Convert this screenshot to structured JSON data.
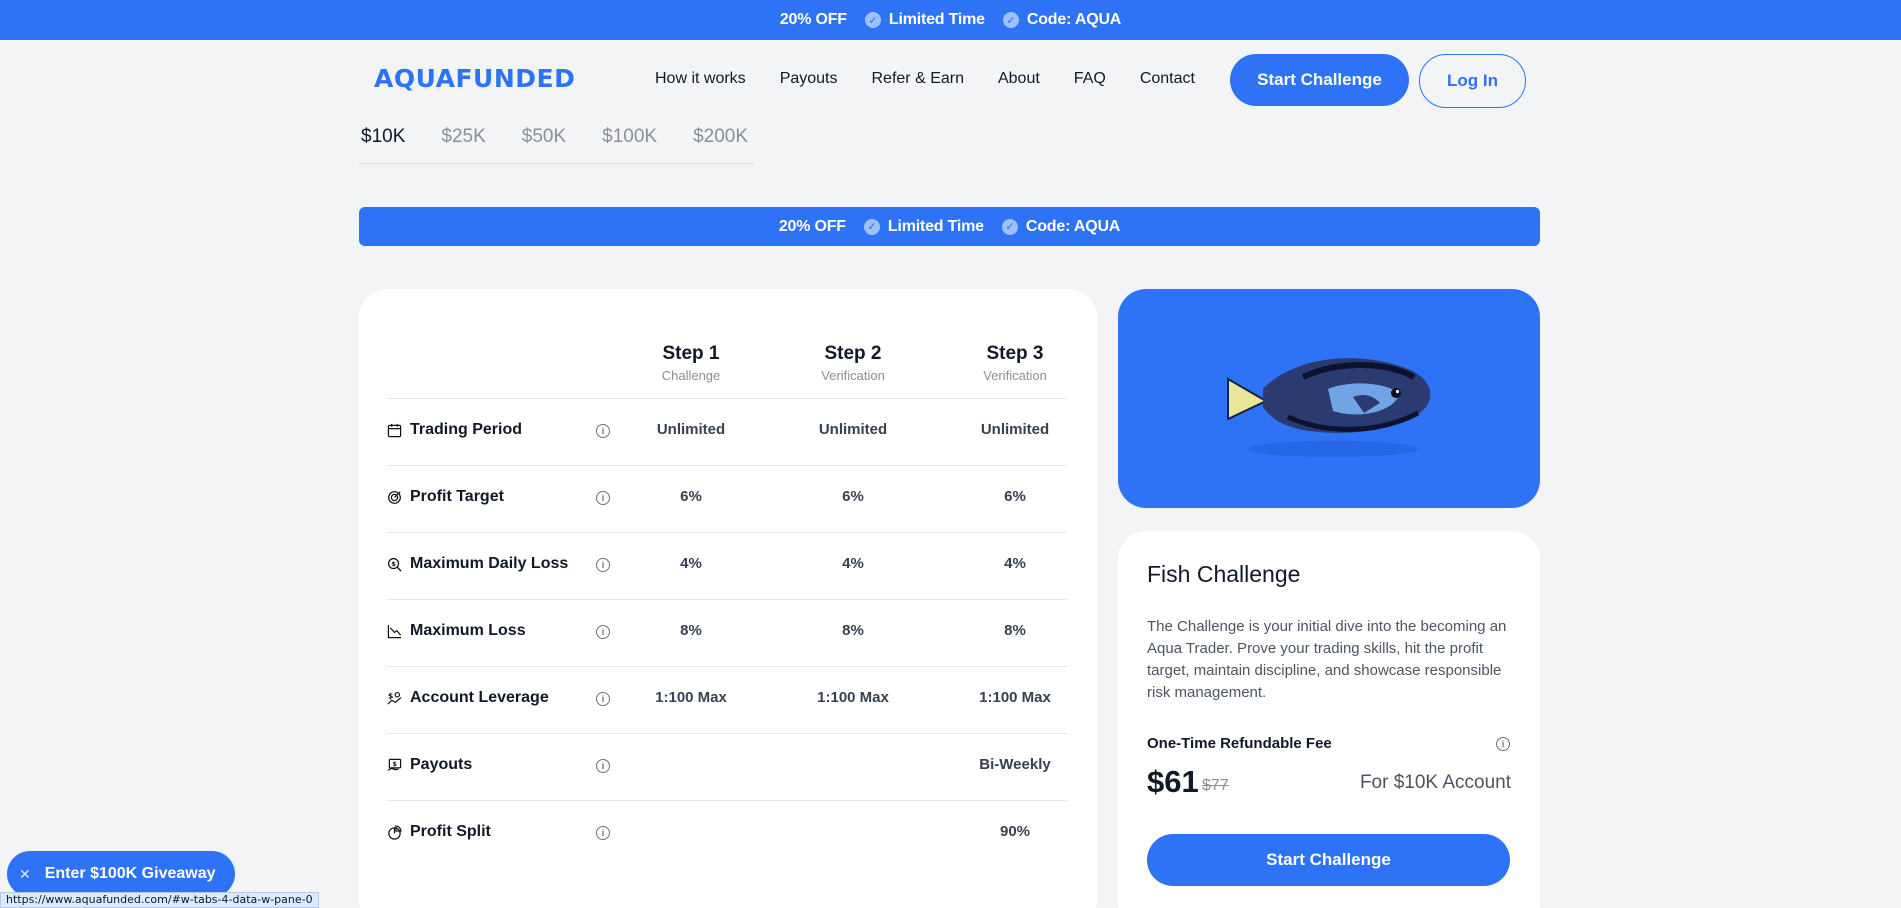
{
  "promo": {
    "discount": "20% OFF",
    "limited": "Limited Time",
    "code": "Code: AQUA"
  },
  "header": {
    "logo": "AQUAFUNDED",
    "nav": [
      "How it works",
      "Payouts",
      "Refer & Earn",
      "About",
      "FAQ",
      "Contact"
    ],
    "start_label": "Start Challenge",
    "login_label": "Log In"
  },
  "account_sizes": [
    "$10K",
    "$25K",
    "$50K",
    "$100K",
    "$200K"
  ],
  "selected_size": "$10K",
  "table": {
    "steps": [
      {
        "title": "Step 1",
        "sub": "Challenge"
      },
      {
        "title": "Step 2",
        "sub": "Verification"
      },
      {
        "title": "Step 3",
        "sub": "Verification"
      }
    ],
    "rows": [
      {
        "label": "Trading Period",
        "icon": "calendar-icon",
        "values": [
          "Unlimited",
          "Unlimited",
          "Unlimited"
        ]
      },
      {
        "label": "Profit Target",
        "icon": "target-icon",
        "values": [
          "6%",
          "6%",
          "6%"
        ]
      },
      {
        "label": "Maximum Daily Loss",
        "icon": "search-money-icon",
        "values": [
          "4%",
          "4%",
          "4%"
        ]
      },
      {
        "label": "Maximum Loss",
        "icon": "chart-down-icon",
        "values": [
          "8%",
          "8%",
          "8%"
        ]
      },
      {
        "label": "Account Leverage",
        "icon": "leverage-icon",
        "values": [
          "1:100 Max",
          "1:100 Max",
          "1:100 Max"
        ]
      },
      {
        "label": "Payouts",
        "icon": "payout-icon",
        "values": [
          "",
          "",
          "Bi-Weekly"
        ]
      },
      {
        "label": "Profit Split",
        "icon": "pie-icon",
        "values": [
          "",
          "",
          "90%"
        ]
      }
    ]
  },
  "challenge": {
    "title": "Fish Challenge",
    "description": "The Challenge is your initial dive into the becoming an Aqua Trader. Prove your trading skills, hit the profit target, maintain discipline, and showcase responsible risk management.",
    "fee_label": "One-Time Refundable Fee",
    "price": "$61",
    "old_price": "$77",
    "for_account": "For $10K Account",
    "cta": "Start Challenge"
  },
  "giveaway": "Enter $100K Giveaway",
  "status_url": "https://www.aquafunded.com/#w-tabs-4-data-w-pane-0",
  "colors": {
    "brand": "#2e73f5",
    "background": "#f3f4f6"
  }
}
